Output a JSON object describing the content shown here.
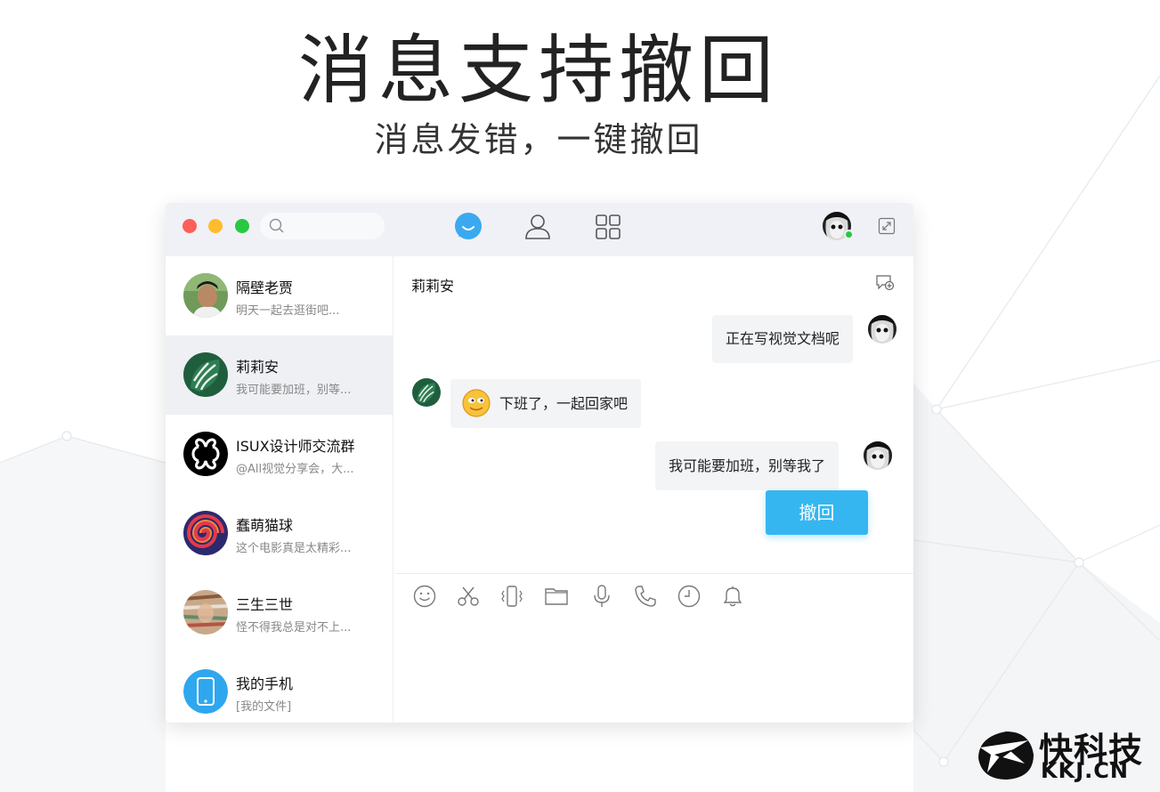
{
  "hero": {
    "title": "消息支持撤回",
    "subtitle": "消息发错，一键撤回"
  },
  "window": {
    "search_placeholder": "",
    "nav": [
      "chat-icon",
      "contacts-icon",
      "apps-grid-icon"
    ],
    "accent": "#35b6f1",
    "online_color": "#29c840"
  },
  "sidebar": {
    "items": [
      {
        "name": "隔壁老贾",
        "preview": "明天一起去逛街吧..."
      },
      {
        "name": "莉莉安",
        "preview": "我可能要加班，别等..."
      },
      {
        "name": "ISUX设计师交流群",
        "preview": "@All视觉分享会，大..."
      },
      {
        "name": "蠢萌猫球",
        "preview": "这个电影真是太精彩..."
      },
      {
        "name": "三生三世",
        "preview": "怪不得我总是对不上..."
      },
      {
        "name": "我的手机",
        "preview": "[我的文件]"
      }
    ]
  },
  "chat": {
    "title": "莉莉安",
    "messages": [
      {
        "from": "me",
        "text": "正在写视觉文档呢"
      },
      {
        "from": "other",
        "text": "下班了，一起回家吧"
      },
      {
        "from": "me",
        "text": "我可能要加班，别等我了"
      }
    ],
    "recall_label": "撤回",
    "toolbar": [
      "smile-icon",
      "scissors-icon",
      "vibrate-icon",
      "folder-icon",
      "microphone-icon",
      "phone-icon",
      "clock-icon",
      "bell-icon"
    ]
  },
  "brand": {
    "name": "快科技",
    "domain": "KKJ.CN"
  }
}
